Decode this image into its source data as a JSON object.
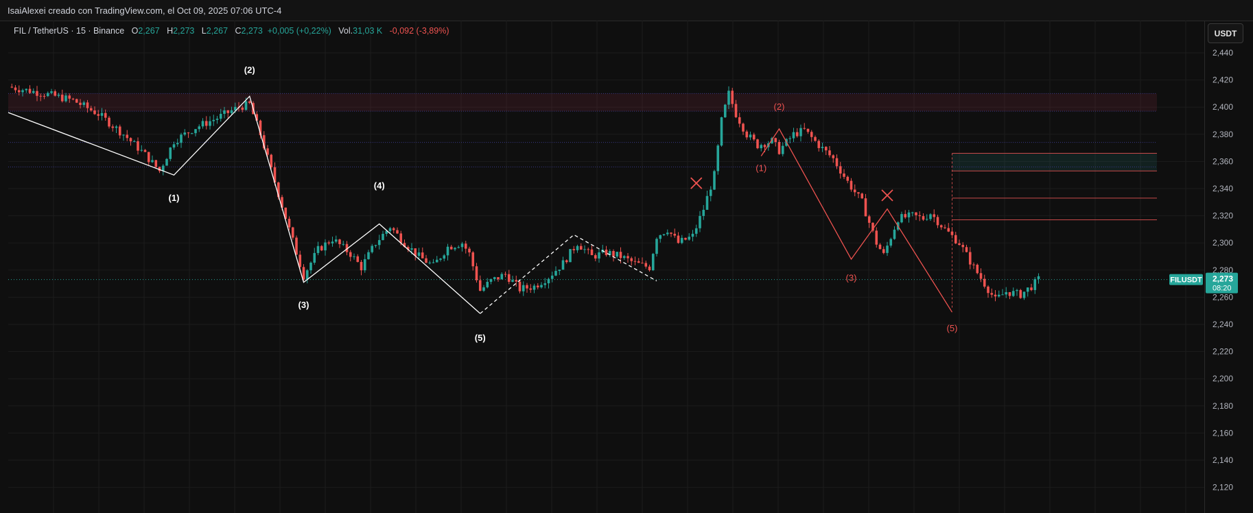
{
  "attribution": "IsaiAlexei creado con TradingView.com, el Oct 09, 2025 07:06 UTC-4",
  "legend": {
    "symbol": "FIL / TetherUS · 15 · Binance",
    "open_label": "O",
    "open": "2,267",
    "high_label": "H",
    "high": "2,273",
    "low_label": "L",
    "low": "2,267",
    "close_label": "C",
    "close": "2,273",
    "change": "+0,005 (+0,22%)",
    "vol_label": "Vol.",
    "vol": "31,03 K",
    "day_change": "-0,092 (-3,89%)"
  },
  "currency_button": "USDT",
  "last_price_tag": {
    "symbol": "FILUSDT",
    "price": "2,273",
    "countdown": "08:20"
  },
  "colors": {
    "up": "#26a69a",
    "down": "#ef5350",
    "background": "#0f0f0f",
    "grid": "#1c1c1c"
  },
  "chart_data": {
    "type": "candlestick",
    "symbol": "FILUSDT",
    "timeframe": "15",
    "ylim": [
      2.108,
      2.458
    ],
    "yticks": [
      2.44,
      2.42,
      2.4,
      2.38,
      2.36,
      2.34,
      2.32,
      2.3,
      2.28,
      2.26,
      2.24,
      2.22,
      2.2,
      2.18,
      2.16,
      2.14,
      2.12
    ],
    "ytick_labels": [
      "2,440",
      "2,420",
      "2,400",
      "2,380",
      "2,360",
      "2,340",
      "2,320",
      "2,300",
      "2,280",
      "2,260",
      "2,240",
      "2,220",
      "2,200",
      "2,180",
      "2,160",
      "2,140",
      "2,120"
    ],
    "bar_count": 200,
    "last_price": 2.273,
    "price_path": [
      [
        0,
        2.415
      ],
      [
        10,
        2.41
      ],
      [
        18,
        2.405
      ],
      [
        25,
        2.395
      ],
      [
        32,
        2.38
      ],
      [
        38,
        2.365
      ],
      [
        42,
        2.353
      ],
      [
        46,
        2.375
      ],
      [
        52,
        2.385
      ],
      [
        58,
        2.392
      ],
      [
        64,
        2.4
      ],
      [
        67,
        2.402
      ],
      [
        70,
        2.38
      ],
      [
        74,
        2.345
      ],
      [
        78,
        2.31
      ],
      [
        82,
        2.276
      ],
      [
        86,
        2.295
      ],
      [
        90,
        2.303
      ],
      [
        95,
        2.292
      ],
      [
        98,
        2.282
      ],
      [
        102,
        2.3
      ],
      [
        106,
        2.312
      ],
      [
        110,
        2.3
      ],
      [
        114,
        2.29
      ],
      [
        118,
        2.283
      ],
      [
        122,
        2.297
      ],
      [
        126,
        2.3
      ],
      [
        128,
        2.292
      ],
      [
        131,
        2.265
      ],
      [
        134,
        2.272
      ],
      [
        138,
        2.277
      ],
      [
        142,
        2.266
      ],
      [
        146,
        2.268
      ],
      [
        150,
        2.275
      ],
      [
        154,
        2.285
      ],
      [
        158,
        2.3
      ],
      [
        162,
        2.29
      ],
      [
        166,
        2.293
      ],
      [
        170,
        2.29
      ],
      [
        174,
        2.285
      ],
      [
        178,
        2.282
      ],
      [
        180,
        2.305
      ],
      [
        183,
        2.31
      ],
      [
        186,
        2.3
      ],
      [
        190,
        2.305
      ],
      [
        193,
        2.325
      ],
      [
        196,
        2.35
      ],
      [
        198,
        2.39
      ],
      [
        200,
        2.41
      ],
      [
        202,
        2.395
      ],
      [
        205,
        2.38
      ],
      [
        208,
        2.372
      ],
      [
        212,
        2.375
      ],
      [
        214,
        2.368
      ],
      [
        218,
        2.38
      ],
      [
        221,
        2.383
      ],
      [
        225,
        2.372
      ],
      [
        229,
        2.362
      ],
      [
        233,
        2.345
      ],
      [
        237,
        2.33
      ],
      [
        241,
        2.3
      ],
      [
        243,
        2.291
      ],
      [
        247,
        2.318
      ],
      [
        251,
        2.32
      ],
      [
        254,
        2.318
      ],
      [
        256,
        2.322
      ],
      [
        260,
        2.31
      ],
      [
        264,
        2.3
      ],
      [
        268,
        2.282
      ],
      [
        272,
        2.266
      ],
      [
        274,
        2.258
      ],
      [
        277,
        2.264
      ],
      [
        281,
        2.262
      ],
      [
        284,
        2.268
      ],
      [
        286,
        2.273
      ]
    ],
    "horizontal_lines": [
      2.41,
      2.397,
      2.374,
      2.356
    ],
    "resistance_zone": [
      2.397,
      2.41
    ],
    "target_box": {
      "bar_start": 262,
      "prices": [
        2.366,
        2.353,
        2.333,
        2.317
      ],
      "top_fill": [
        2.353,
        2.366
      ]
    },
    "elliott_waves": [
      {
        "color": "#ffffff",
        "line": [
          [
            0,
            2.396
          ],
          [
            46,
            2.35
          ],
          [
            67,
            2.408
          ],
          [
            82,
            2.271
          ],
          [
            103,
            2.314
          ],
          [
            131,
            2.248
          ]
        ],
        "labels": [
          {
            "text": "(1)",
            "bar": 46,
            "price": 2.331
          },
          {
            "text": "(2)",
            "bar": 67,
            "price": 2.425
          },
          {
            "text": "(3)",
            "bar": 82,
            "price": 2.252
          },
          {
            "text": "(4)",
            "bar": 103,
            "price": 2.34
          },
          {
            "text": "(5)",
            "bar": 131,
            "price": 2.228
          }
        ]
      },
      {
        "color": "#ffffff",
        "dashed": true,
        "line": [
          [
            131,
            2.248
          ],
          [
            157,
            2.306
          ],
          [
            180,
            2.272
          ]
        ]
      },
      {
        "color": "#ef5350",
        "line": [
          [
            209,
            2.364
          ],
          [
            214,
            2.384
          ],
          [
            234,
            2.288
          ],
          [
            244,
            2.325
          ],
          [
            262,
            2.249
          ]
        ],
        "labels": [
          {
            "text": "(1)",
            "bar": 209,
            "price": 2.353
          },
          {
            "text": "(2)",
            "bar": 214,
            "price": 2.398
          },
          {
            "text": "(3)",
            "bar": 234,
            "price": 2.272
          },
          {
            "text": "(5)",
            "bar": 262,
            "price": 2.235
          }
        ]
      }
    ],
    "cross_markers": [
      {
        "bar": 191,
        "price": 2.344
      },
      {
        "bar": 244,
        "price": 2.335
      }
    ]
  }
}
